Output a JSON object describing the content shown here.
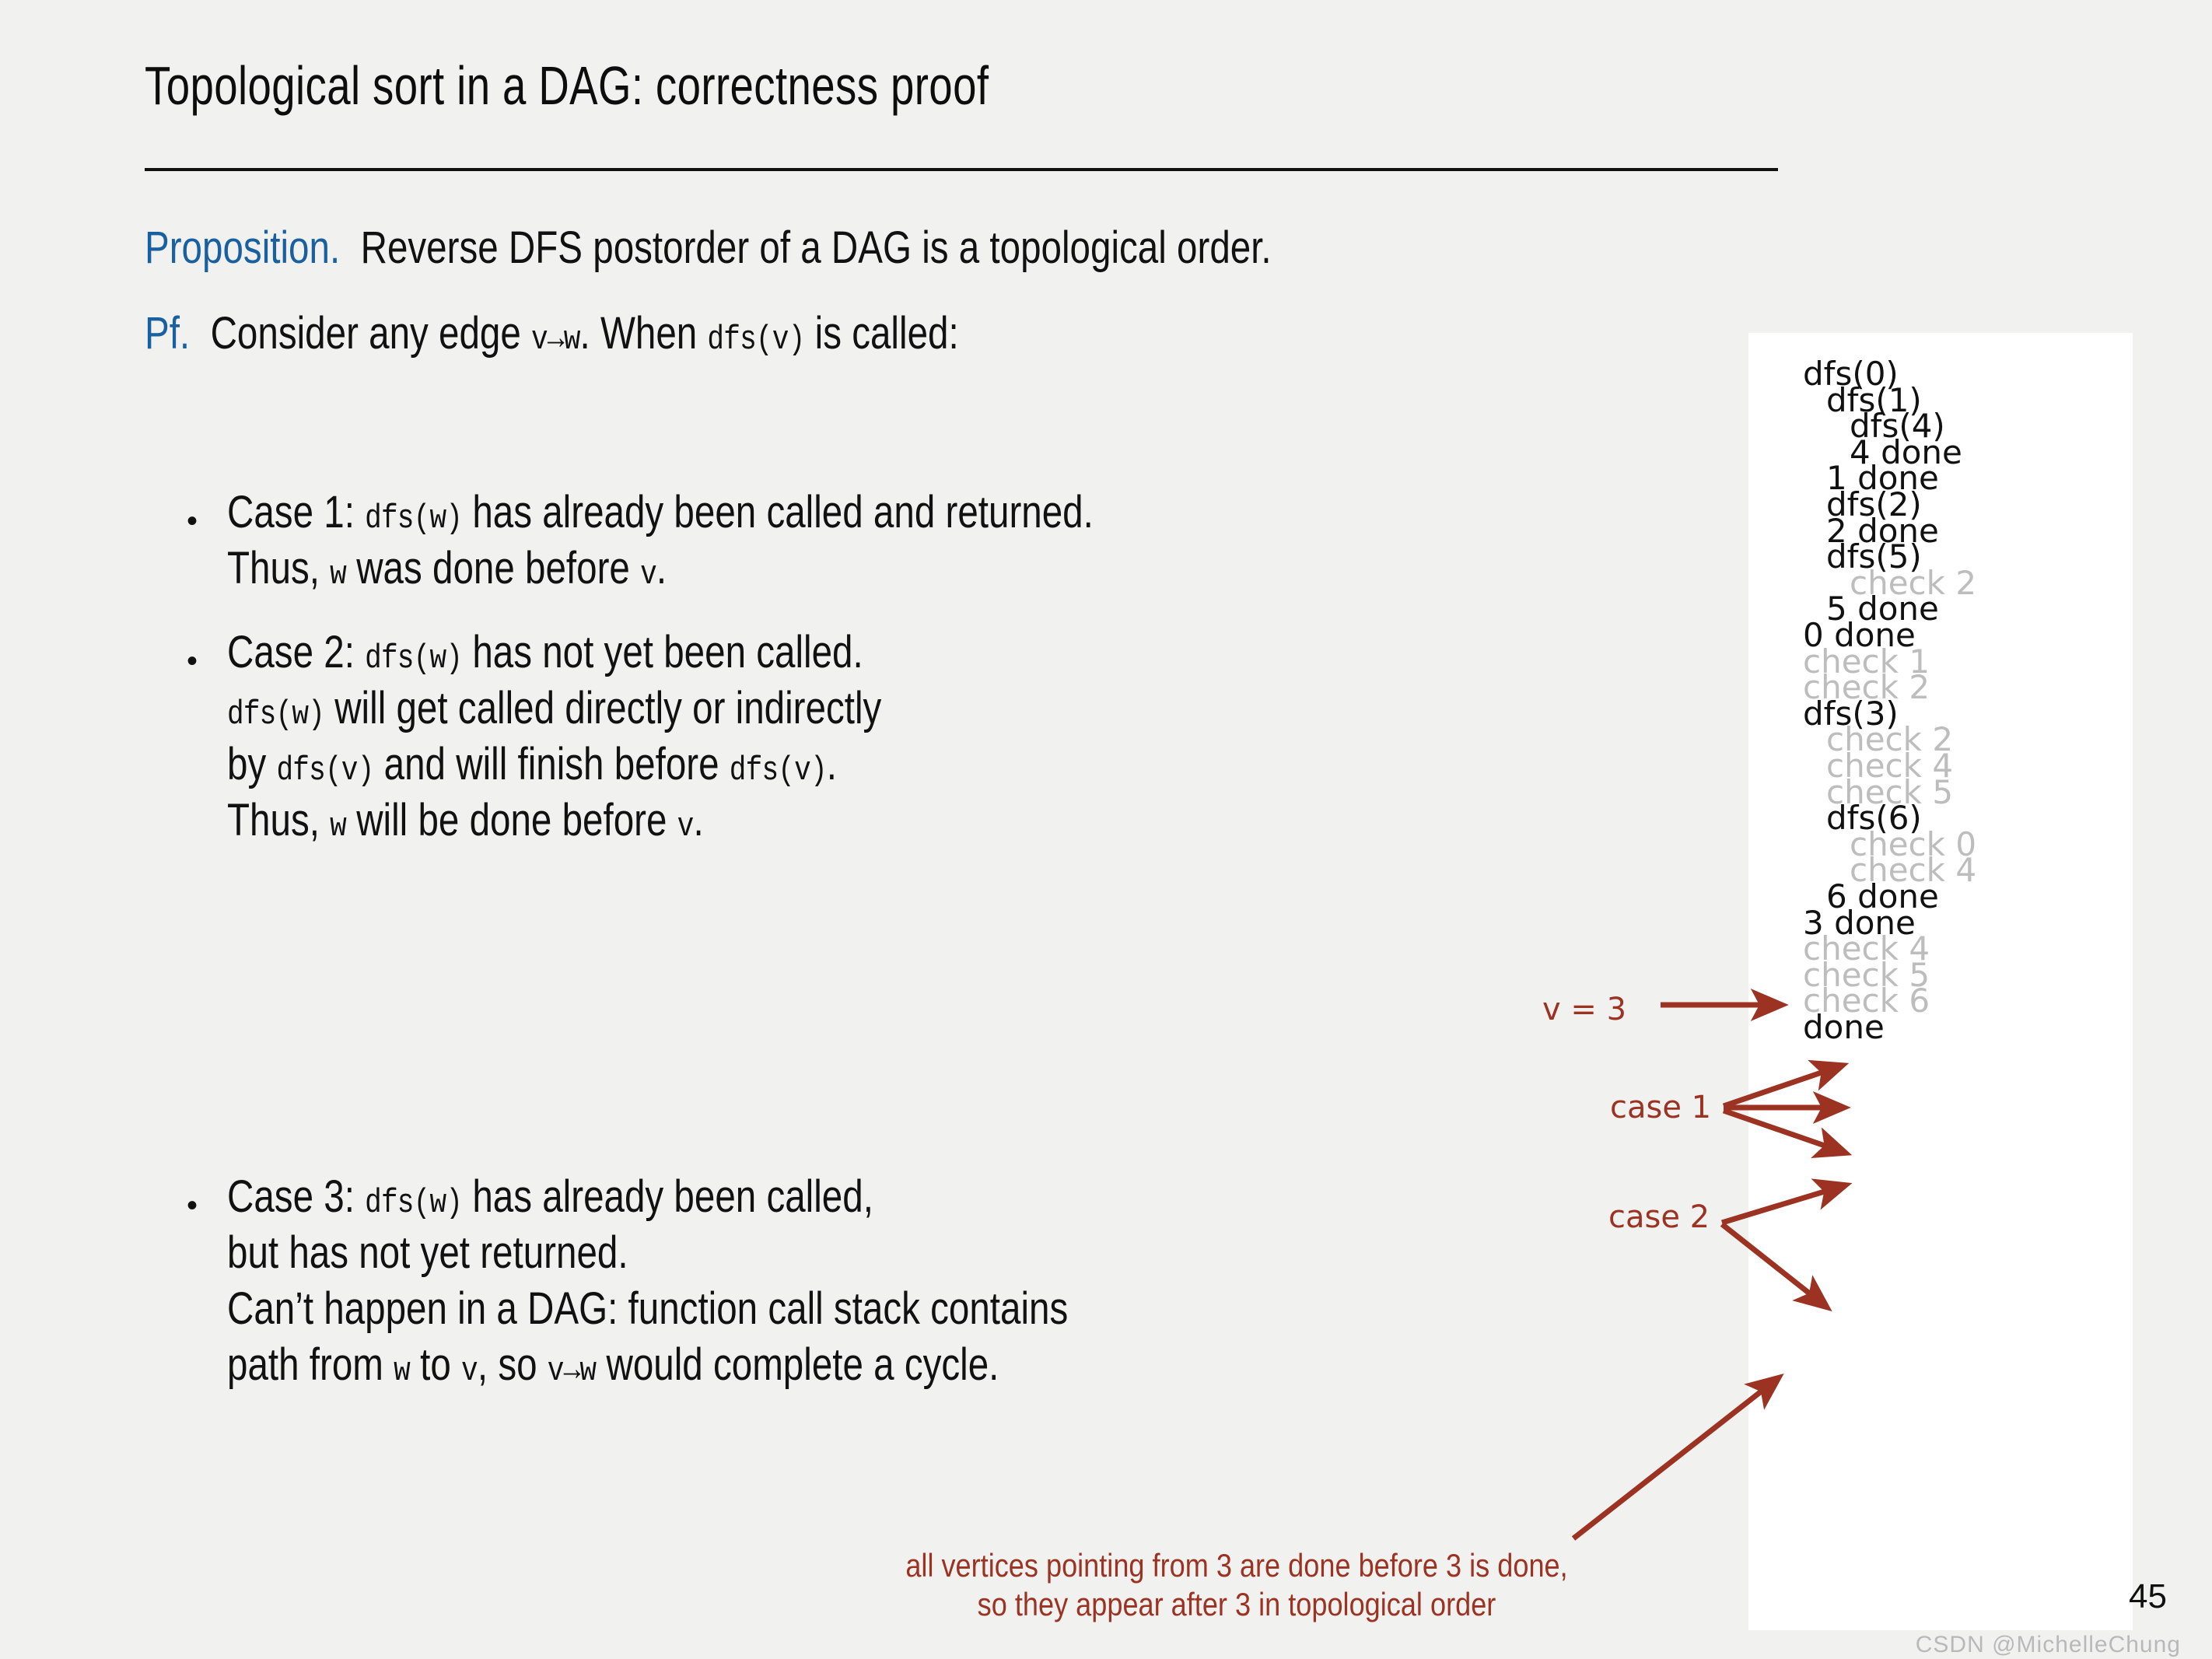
{
  "slide": {
    "title": "Topological sort in a DAG:  correctness proof",
    "page_number": "45",
    "watermark": "CSDN @MichelleChung",
    "accent_blue": "#18609f",
    "accent_red": "#9c3322",
    "dim_gray": "#bdbdbd",
    "background": "#f1f1f0",
    "panel_background": "#ffffff"
  },
  "proposition": {
    "label": "Proposition.",
    "text": "Reverse DFS postorder of a DAG is a topological order."
  },
  "proof": {
    "label": "Pf.",
    "text_a": "Consider any edge ",
    "edge": "v→w",
    "text_b": ". When ",
    "call": "dfs(v)",
    "text_c": " is called:"
  },
  "cases": [
    {
      "bullet": "•",
      "lines": [
        {
          "parts": [
            {
              "t": "Case 1:  ",
              "s": "plain"
            },
            {
              "t": "dfs(w)",
              "s": "mono"
            },
            {
              "t": " has already been called and returned.",
              "s": "plain"
            }
          ]
        },
        {
          "parts": [
            {
              "t": "Thus, ",
              "s": "plain"
            },
            {
              "t": "w",
              "s": "mono"
            },
            {
              "t": " was done before ",
              "s": "plain"
            },
            {
              "t": "v",
              "s": "mono"
            },
            {
              "t": ".",
              "s": "plain"
            }
          ]
        }
      ]
    },
    {
      "bullet": "•",
      "lines": [
        {
          "parts": [
            {
              "t": "Case 2:  ",
              "s": "plain"
            },
            {
              "t": "dfs(w)",
              "s": "mono"
            },
            {
              "t": " has not yet been called.",
              "s": "plain"
            }
          ]
        },
        {
          "parts": [
            {
              "t": "dfs(w)",
              "s": "mono"
            },
            {
              "t": " will get called directly or indirectly",
              "s": "plain"
            }
          ]
        },
        {
          "parts": [
            {
              "t": "by ",
              "s": "plain"
            },
            {
              "t": "dfs(v)",
              "s": "mono"
            },
            {
              "t": " and will finish before ",
              "s": "plain"
            },
            {
              "t": "dfs(v)",
              "s": "mono"
            },
            {
              "t": ".",
              "s": "plain"
            }
          ]
        },
        {
          "parts": [
            {
              "t": "Thus, ",
              "s": "plain"
            },
            {
              "t": "w",
              "s": "mono"
            },
            {
              "t": " will be done before ",
              "s": "plain"
            },
            {
              "t": "v",
              "s": "mono"
            },
            {
              "t": ".",
              "s": "plain"
            }
          ]
        }
      ]
    },
    {
      "bullet": "•",
      "lines": [
        {
          "parts": [
            {
              "t": "Case 3:  ",
              "s": "plain"
            },
            {
              "t": "dfs(w)",
              "s": "mono"
            },
            {
              "t": " has already been called,",
              "s": "plain"
            }
          ]
        },
        {
          "parts": [
            {
              "t": "but has not yet returned.",
              "s": "plain"
            }
          ]
        },
        {
          "parts": [
            {
              "t": "Can’t happen in a DAG: function call stack contains",
              "s": "plain"
            }
          ]
        },
        {
          "parts": [
            {
              "t": "path from ",
              "s": "plain"
            },
            {
              "t": "w",
              "s": "mono"
            },
            {
              "t": " to ",
              "s": "plain"
            },
            {
              "t": "v",
              "s": "mono"
            },
            {
              "t": ", so ",
              "s": "plain"
            },
            {
              "t": "v→w",
              "s": "mono"
            },
            {
              "t": " would complete a cycle.",
              "s": "plain"
            }
          ]
        }
      ]
    }
  ],
  "trace": {
    "lines": [
      {
        "text": "dfs(0)",
        "indent": 0,
        "dim": false
      },
      {
        "text": "dfs(1)",
        "indent": 1,
        "dim": false
      },
      {
        "text": "dfs(4)",
        "indent": 2,
        "dim": false
      },
      {
        "text": "4 done",
        "indent": 2,
        "dim": false
      },
      {
        "text": "1 done",
        "indent": 1,
        "dim": false
      },
      {
        "text": "dfs(2)",
        "indent": 1,
        "dim": false
      },
      {
        "text": "2 done",
        "indent": 1,
        "dim": false
      },
      {
        "text": "dfs(5)",
        "indent": 1,
        "dim": false
      },
      {
        "text": "check 2",
        "indent": 2,
        "dim": true
      },
      {
        "text": "5 done",
        "indent": 1,
        "dim": false
      },
      {
        "text": "0 done",
        "indent": 0,
        "dim": false
      },
      {
        "text": "check 1",
        "indent": 0,
        "dim": true
      },
      {
        "text": "check 2",
        "indent": 0,
        "dim": true
      },
      {
        "text": "dfs(3)",
        "indent": 0,
        "dim": false
      },
      {
        "text": "check 2",
        "indent": 1,
        "dim": true
      },
      {
        "text": "check 4",
        "indent": 1,
        "dim": true
      },
      {
        "text": "check 5",
        "indent": 1,
        "dim": true
      },
      {
        "text": "dfs(6)",
        "indent": 1,
        "dim": false
      },
      {
        "text": "check 0",
        "indent": 2,
        "dim": true
      },
      {
        "text": "check 4",
        "indent": 2,
        "dim": true
      },
      {
        "text": "6 done",
        "indent": 1,
        "dim": false
      },
      {
        "text": "3 done",
        "indent": 0,
        "dim": false
      },
      {
        "text": "check 4",
        "indent": 0,
        "dim": true
      },
      {
        "text": "check 5",
        "indent": 0,
        "dim": true
      },
      {
        "text": "check 6",
        "indent": 0,
        "dim": true
      },
      {
        "text": "done",
        "indent": 0,
        "dim": false
      }
    ]
  },
  "annotations": {
    "v_label": "v = 3",
    "case1_label": "case 1",
    "case2_label": "case 2",
    "caption_line1": "all vertices pointing from 3 are done before 3 is done,",
    "caption_line2": "so they appear after 3 in topological order"
  }
}
